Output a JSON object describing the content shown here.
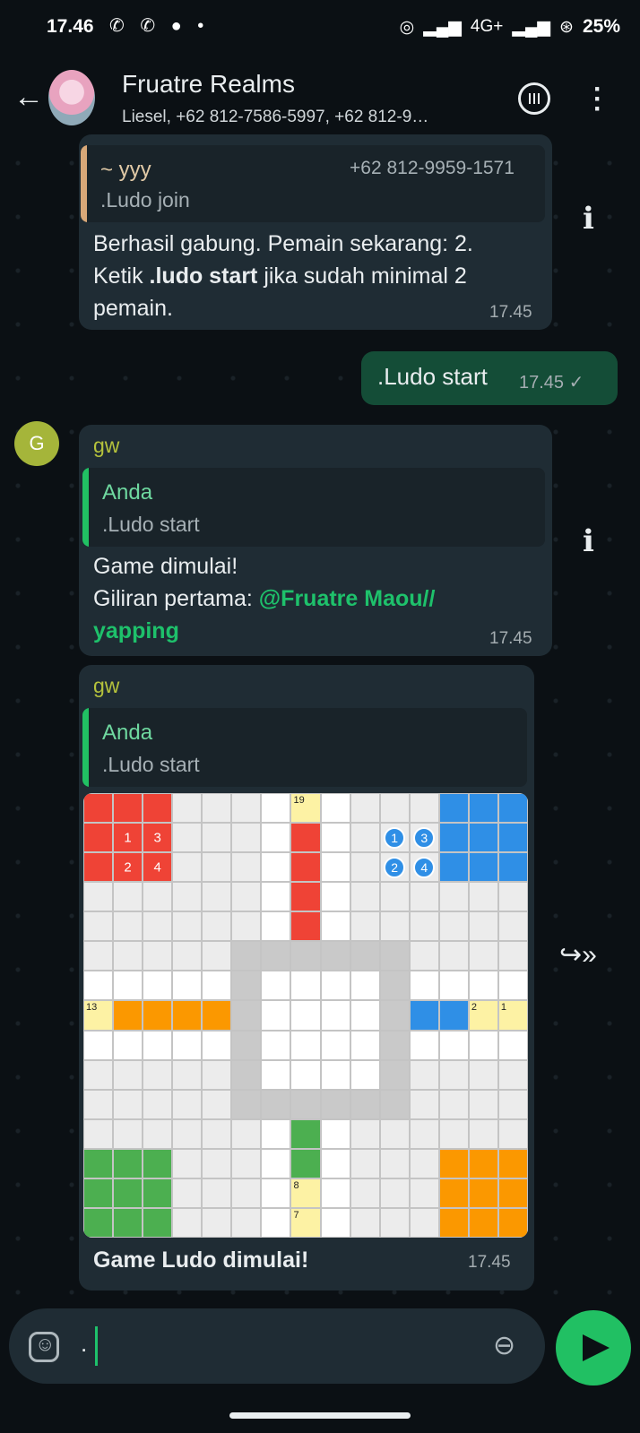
{
  "status": {
    "time": "17.46",
    "left_icons": [
      "whatsapp-icon",
      "whatsapp-business-icon",
      "chat-icon",
      "dot"
    ],
    "network": "4G+",
    "battery": "25%"
  },
  "header": {
    "title": "Fruatre Realms",
    "subtitle": "Liesel, +62 812-7586-5997, +62 812-9…"
  },
  "messages": {
    "m1": {
      "quote_name": "~ yyy",
      "quote_phone": "+62 812-9959-1571",
      "quote_text": ".Ludo join",
      "text_line1": "Berhasil gabung. Pemain sekarang: 2.",
      "text_pre": "Ketik ",
      "text_bold": ".ludo start",
      "text_post": " jika sudah minimal 2",
      "text_line3": "pemain.",
      "time": "17.45"
    },
    "m2": {
      "text": ".Ludo start",
      "time": "17.45 ✓"
    },
    "m3": {
      "avatar_letter": "G",
      "sender": "gw",
      "quote_name": "Anda",
      "quote_text": ".Ludo start",
      "line1": "Game dimulai!",
      "line2_pre": "Giliran pertama: ",
      "mention1": "@Fruatre Maou//",
      "mention2": "yapping",
      "time": "17.45"
    },
    "m4": {
      "sender": "gw",
      "quote_name": "Anda",
      "quote_text": ".Ludo start",
      "caption": "Game Ludo dimulai!",
      "time": "17.45"
    }
  },
  "board": {
    "labels": {
      "19": "19",
      "13": "13",
      "2": "2",
      "1": "1",
      "8": "8",
      "7": "7"
    },
    "red_pieces": [
      "1",
      "3",
      "2",
      "4"
    ],
    "blue_pieces": [
      "1",
      "3",
      "2",
      "4"
    ]
  },
  "input": {
    "value": "."
  },
  "colors": {
    "accent": "#21c063",
    "outgoing_bubble": "#144d37",
    "incoming_bubble": "#1f2c34",
    "red": "#ef4336",
    "blue": "#2f8fe6",
    "green": "#4caf50",
    "orange": "#fb9800",
    "yellow": "#fdf2a4"
  }
}
